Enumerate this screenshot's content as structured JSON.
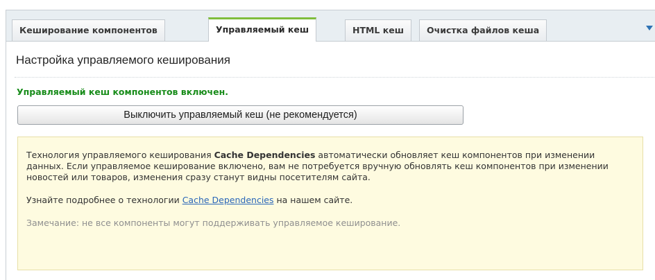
{
  "tabs": [
    {
      "label": "Кеширование компонентов",
      "active": false
    },
    {
      "label": "Управляемый кеш",
      "active": true
    },
    {
      "label": "HTML кеш",
      "active": false
    },
    {
      "label": "Очистка файлов кеша",
      "active": false
    }
  ],
  "tab_menu_icon": "chevron-down-icon",
  "section": {
    "title": "Настройка управляемого кеширования",
    "status": "Управляемый кеш компонентов включен.",
    "toggle_button_label": "Выключить управляемый кеш (не рекомендуется)"
  },
  "notice": {
    "p1_before": "Технология управляемого кеширования ",
    "p1_bold": "Cache Dependencies",
    "p1_after": " автоматически обновляет кеш компонентов при изменении данных. Если управляемое кеширование включено, вам не потребуется вручную обновлять кеш компонентов при изменении новостей или товаров, изменения сразу станут видны посетителям сайта.",
    "p2_before": "Узнайте подробнее о технологии ",
    "p2_link": "Cache Dependencies",
    "p2_after": " на нашем сайте.",
    "note": "Замечание: не все компоненты могут поддерживать управляемое кеширование."
  },
  "colors": {
    "active_tab_accent": "#7fbd3c",
    "status_text": "#188c1a",
    "notice_background": "#fefbe0",
    "link": "#2a66b8"
  }
}
